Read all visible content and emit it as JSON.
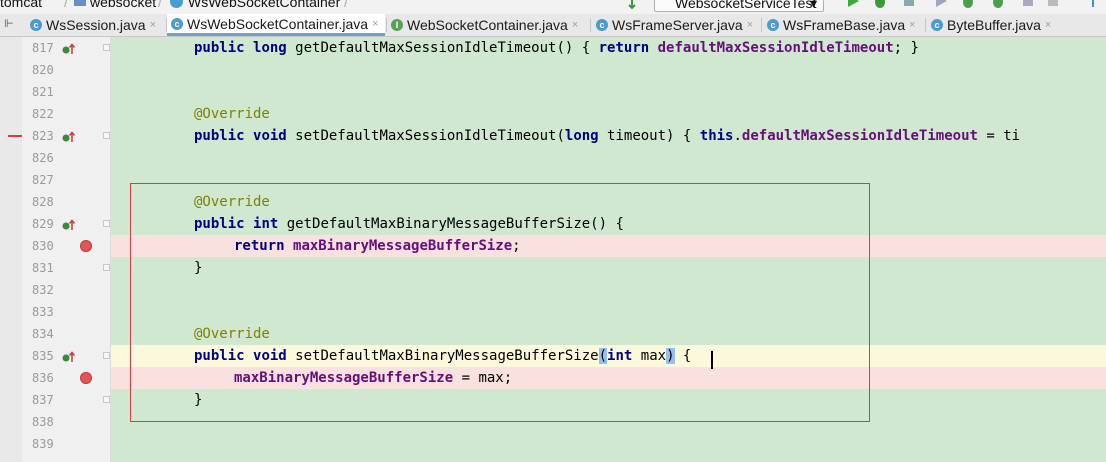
{
  "breadcrumb": {
    "items": [
      "tomcat",
      "websocket",
      "WsWebSocketContainer"
    ]
  },
  "run_config": {
    "label": "WebsocketServiceTest"
  },
  "tabs": [
    {
      "label": "WsSession.java",
      "kind": "class",
      "active": false
    },
    {
      "label": "WsWebSocketContainer.java",
      "kind": "class",
      "active": true
    },
    {
      "label": "WebSocketContainer.java",
      "kind": "interface",
      "active": false
    },
    {
      "label": "WsFrameServer.java",
      "kind": "class",
      "active": false
    },
    {
      "label": "WsFrameBase.java",
      "kind": "class",
      "active": false
    },
    {
      "label": "ByteBuffer.java",
      "kind": "class",
      "active": false
    }
  ],
  "tab_close_glyph": "×",
  "lines": [
    {
      "num": "817",
      "indent": 4,
      "tokens": [
        [
          "kw",
          "public"
        ],
        [
          "plain",
          " "
        ],
        [
          "kw",
          "long"
        ],
        [
          "plain",
          " getDefaultMaxSessionIdleTimeout() { "
        ],
        [
          "kw",
          "return"
        ],
        [
          "plain",
          " "
        ],
        [
          "fld",
          "defaultMaxSessionIdleTimeout"
        ],
        [
          "plain",
          "; }"
        ]
      ]
    },
    {
      "num": "820",
      "indent": 0,
      "tokens": []
    },
    {
      "num": "821",
      "indent": 0,
      "tokens": []
    },
    {
      "num": "822",
      "indent": 4,
      "tokens": [
        [
          "ann",
          "@Override"
        ]
      ]
    },
    {
      "num": "823",
      "indent": 4,
      "tokens": [
        [
          "kw",
          "public"
        ],
        [
          "plain",
          " "
        ],
        [
          "kw",
          "void"
        ],
        [
          "plain",
          " setDefaultMaxSessionIdleTimeout("
        ],
        [
          "kw",
          "long"
        ],
        [
          "plain",
          " timeout) { "
        ],
        [
          "kw",
          "this"
        ],
        [
          "plain",
          "."
        ],
        [
          "fld",
          "defaultMaxSessionIdleTimeout"
        ],
        [
          "plain",
          " = ti"
        ]
      ]
    },
    {
      "num": "826",
      "indent": 0,
      "tokens": []
    },
    {
      "num": "827",
      "indent": 0,
      "tokens": []
    },
    {
      "num": "828",
      "indent": 4,
      "tokens": [
        [
          "ann",
          "@Override"
        ]
      ]
    },
    {
      "num": "829",
      "indent": 4,
      "tokens": [
        [
          "kw",
          "public"
        ],
        [
          "plain",
          " "
        ],
        [
          "kw",
          "int"
        ],
        [
          "plain",
          " getDefaultMaxBinaryMessageBufferSize() {"
        ]
      ]
    },
    {
      "num": "830",
      "indent": 8,
      "tokens": [
        [
          "kw",
          "return"
        ],
        [
          "plain",
          " "
        ],
        [
          "fld",
          "maxBinaryMessageBufferSize"
        ],
        [
          "plain",
          ";"
        ]
      ]
    },
    {
      "num": "831",
      "indent": 4,
      "tokens": [
        [
          "plain",
          "}"
        ]
      ]
    },
    {
      "num": "832",
      "indent": 0,
      "tokens": []
    },
    {
      "num": "833",
      "indent": 0,
      "tokens": []
    },
    {
      "num": "834",
      "indent": 4,
      "tokens": [
        [
          "ann",
          "@Override"
        ]
      ]
    },
    {
      "num": "835",
      "indent": 4,
      "tokens": [
        [
          "kw",
          "public"
        ],
        [
          "plain",
          " "
        ],
        [
          "kw",
          "void"
        ],
        [
          "plain",
          " setDefaultMaxBinaryMessageBufferSize"
        ],
        [
          "sel",
          "("
        ],
        [
          "kw",
          "int"
        ],
        [
          "plain",
          " max"
        ],
        [
          "sel",
          ")"
        ],
        [
          "plain",
          " {"
        ]
      ]
    },
    {
      "num": "836",
      "indent": 8,
      "tokens": [
        [
          "fld",
          "maxBinaryMessageBufferSize"
        ],
        [
          "plain",
          " = max;"
        ]
      ]
    },
    {
      "num": "837",
      "indent": 4,
      "tokens": [
        [
          "plain",
          "}"
        ]
      ]
    },
    {
      "num": "838",
      "indent": 0,
      "tokens": []
    },
    {
      "num": "839",
      "indent": 0,
      "tokens": []
    }
  ],
  "colors": {
    "editor_bg": "#cfe8cf",
    "keyword": "#000080",
    "field": "#660e7a",
    "annotation": "#808000",
    "breakpoint": "#e05555",
    "highlight_box": "#e03a3a"
  }
}
